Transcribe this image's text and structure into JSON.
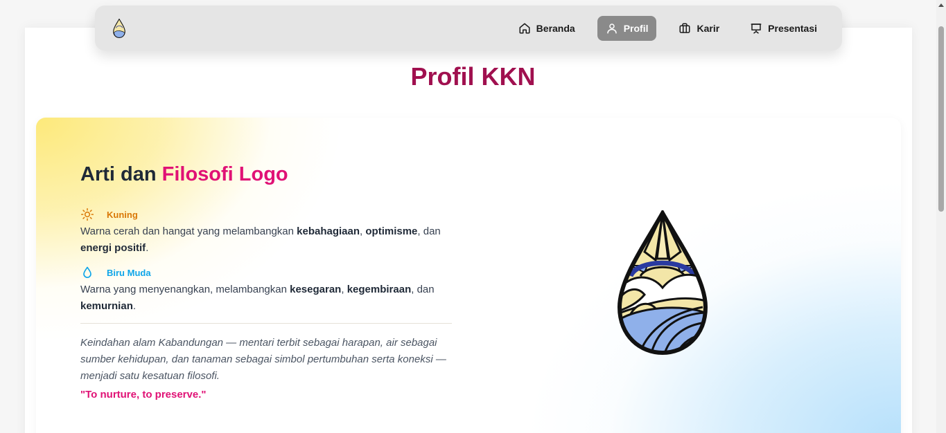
{
  "nav": {
    "items": [
      {
        "label": "Beranda",
        "icon": "home-icon",
        "active": false
      },
      {
        "label": "Profil",
        "icon": "user-icon",
        "active": true
      },
      {
        "label": "Karir",
        "icon": "briefcase-icon",
        "active": false
      },
      {
        "label": "Presentasi",
        "icon": "presentation-icon",
        "active": false
      }
    ]
  },
  "page": {
    "title": "Profil KKN"
  },
  "hero": {
    "heading_plain": "Arti dan ",
    "heading_accent": "Filosofi Logo",
    "colors": [
      {
        "name": "Kuning",
        "icon": "sun-icon",
        "label_color": "#d97706",
        "desc": {
          "t1": "Warna cerah dan hangat yang melambangkan ",
          "b1": "kebahagiaan",
          "t2": ", ",
          "b2": "optimisme",
          "t3": ", dan ",
          "b3": "energi positif",
          "t4": "."
        }
      },
      {
        "name": "Biru Muda",
        "icon": "droplet-icon",
        "label_color": "#0ea5e9",
        "desc": {
          "t1": "Warna yang menyenangkan, melambangkan ",
          "b1": "kesegaran",
          "t2": ", ",
          "b2": "kegembiraan",
          "t3": ", dan ",
          "b3": "kemurnian",
          "t4": "."
        }
      }
    ],
    "quote": "Keindahan alam Kabandungan — mentari terbit sebagai harapan, air sebagai sumber kehidupan, dan tanaman sebagai simbol pertumbuhan serta koneksi — menjadi satu kesatuan filosofi.",
    "tagline": "\"To nurture, to preserve.\""
  },
  "theme": {
    "title_color": "#a0104f",
    "accent_color": "#e01175"
  }
}
